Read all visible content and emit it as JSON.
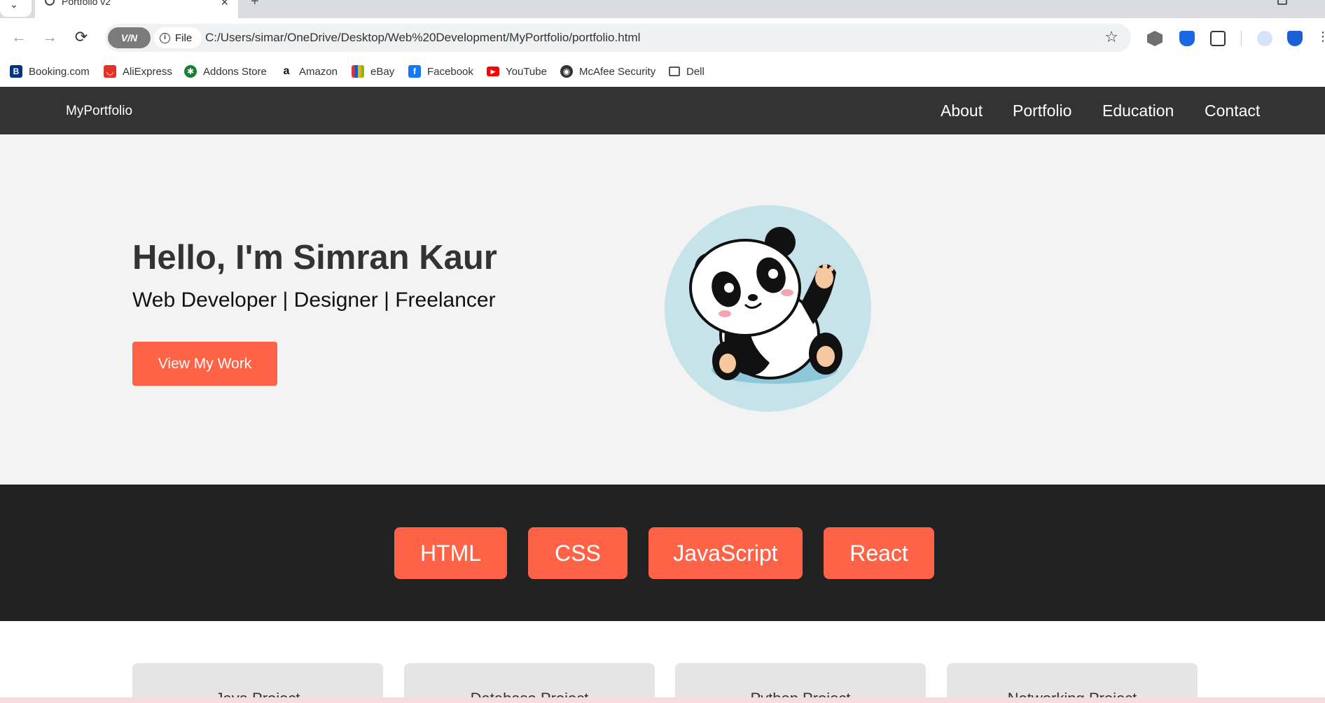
{
  "browser": {
    "tab_title": "Portfolio v2",
    "address": {
      "vpn_label": "V/N",
      "scheme_label": "File",
      "url": "C:/Users/simar/OneDrive/Desktop/Web%20Development/MyPortfolio/portfolio.html"
    },
    "bookmarks": [
      {
        "label": "Booking.com",
        "icon": "booking-icon",
        "color": "#003580"
      },
      {
        "label": "AliExpress",
        "icon": "aliexpress-icon",
        "color": "#e43225"
      },
      {
        "label": "Addons Store",
        "icon": "addons-store-icon",
        "color": "#1a7f37"
      },
      {
        "label": "Amazon",
        "icon": "amazon-icon",
        "color": "#111111"
      },
      {
        "label": "eBay",
        "icon": "ebay-icon",
        "color": "#e53238"
      },
      {
        "label": "Facebook",
        "icon": "facebook-icon",
        "color": "#1877f2"
      },
      {
        "label": "YouTube",
        "icon": "youtube-icon",
        "color": "#ff0000"
      },
      {
        "label": "McAfee Security",
        "icon": "mcafee-icon",
        "color": "#333333"
      },
      {
        "label": "Dell",
        "icon": "folder-icon",
        "color": "#555555"
      }
    ]
  },
  "site": {
    "brand": "MyPortfolio",
    "nav": [
      "About",
      "Portfolio",
      "Education",
      "Contact"
    ],
    "hero": {
      "heading": "Hello, I'm Simran Kaur",
      "subtitle": "Web Developer | Designer | Freelancer",
      "cta": "View My Work"
    },
    "skills": [
      "HTML",
      "CSS",
      "JavaScript",
      "React"
    ],
    "projects": [
      "Java Project",
      "Database Project",
      "Python Project",
      "Networking Project"
    ]
  },
  "colors": {
    "accent": "#ff6347",
    "nav_bg": "#333333",
    "skills_bg": "#222222",
    "hero_bg": "#f3f3f3"
  }
}
